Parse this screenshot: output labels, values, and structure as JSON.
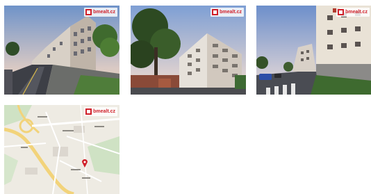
{
  "gallery": {
    "photos": [
      {
        "watermark": "bmealt.cz",
        "icon": "logo-icon"
      },
      {
        "watermark": "bmealt.cz",
        "icon": "logo-icon"
      },
      {
        "watermark": "bmealt.cz",
        "icon": "logo-icon"
      },
      {
        "watermark": "bmealt.cz",
        "icon": "logo-icon"
      }
    ]
  },
  "colors": {
    "watermark_red": "#d0202a",
    "background": "#ffffff"
  }
}
